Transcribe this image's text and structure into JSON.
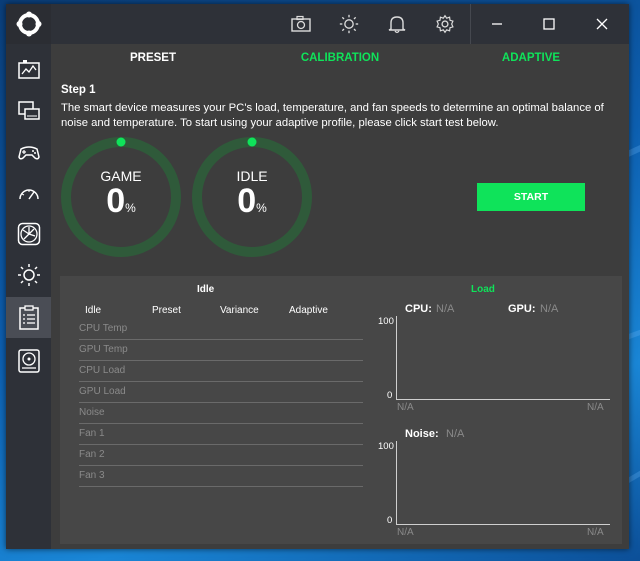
{
  "colors": {
    "accent": "#0fe35a",
    "ring_track": "#2f5a3a",
    "window_bg": "#3d3d3d",
    "sidebar_bg": "#2e3138"
  },
  "sidebar": {
    "logo_icon": "app-logo-icon",
    "items": [
      {
        "icon": "dashboard-icon"
      },
      {
        "icon": "monitor-icon"
      },
      {
        "icon": "gamepad-icon"
      },
      {
        "icon": "gauge-icon"
      },
      {
        "icon": "fan-icon"
      },
      {
        "icon": "brightness-icon"
      },
      {
        "icon": "clipboard-icon",
        "active": true
      },
      {
        "icon": "storage-icon"
      }
    ]
  },
  "titlebar": {
    "icons": [
      "camera-icon",
      "brightness-icon",
      "bell-icon",
      "gear-icon"
    ],
    "window_controls": [
      "minimize-icon",
      "maximize-icon",
      "close-icon"
    ]
  },
  "tabs": [
    {
      "label": "PRESET",
      "active": true
    },
    {
      "label": "CALIBRATION",
      "active": false
    },
    {
      "label": "ADAPTIVE",
      "active": false
    }
  ],
  "step": {
    "title": "Step 1",
    "description": "The smart device measures your PC's load, temperature, and fan speeds to determine an optimal balance of noise and temperature. To start using your adaptive profile, please click start test below."
  },
  "rings": [
    {
      "label": "GAME",
      "value": "0",
      "unit": "%"
    },
    {
      "label": "IDLE",
      "value": "0",
      "unit": "%"
    }
  ],
  "start_button": "START",
  "results": {
    "idle_heading": "Idle",
    "load_heading": "Load",
    "columns": [
      "Idle",
      "Preset",
      "Variance",
      "Adaptive"
    ],
    "rows": [
      "CPU Temp",
      "GPU Temp",
      "CPU Load",
      "GPU Load",
      "Noise",
      "Fan 1",
      "Fan 2",
      "Fan 3"
    ],
    "chart1": {
      "cpu_label": "CPU:",
      "cpu_value": "N/A",
      "gpu_label": "GPU:",
      "gpu_value": "N/A",
      "y_max": "100",
      "y_min": "0",
      "x_left": "N/A",
      "x_right": "N/A"
    },
    "chart2": {
      "noise_label": "Noise:",
      "noise_value": "N/A",
      "y_max": "100",
      "y_min": "0",
      "x_left": "N/A",
      "x_right": "N/A"
    }
  }
}
